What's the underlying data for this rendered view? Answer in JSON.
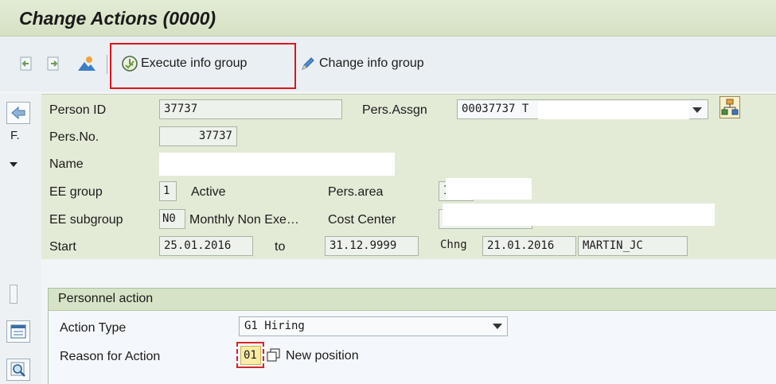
{
  "title": "Change Actions (0000)",
  "toolbar": {
    "execute_label": "Execute info group",
    "change_label": "Change info group",
    "highlight_color": "#e0141b"
  },
  "leftnav": {
    "f_label": "F."
  },
  "header": {
    "person_id_label": "Person ID",
    "person_id_value": "37737",
    "pers_assgn_label": "Pers.Assgn",
    "pers_assgn_value": "00037737 T",
    "pers_no_label": "Pers.No.",
    "pers_no_value": "37737",
    "name_label": "Name",
    "ee_group_label": "EE group",
    "ee_group_code": "1",
    "ee_group_text": "Active",
    "pers_area_label": "Pers.area",
    "pers_area_value": "I",
    "ee_subgroup_label": "EE subgroup",
    "ee_subgroup_code": "N0",
    "ee_subgroup_text": "Monthly Non Exe…",
    "cost_center_label": "Cost Center",
    "start_label": "Start",
    "start_value": "25.01.2016",
    "to_label": "to",
    "end_value": "31.12.9999",
    "chng_label": "Chng",
    "chng_date": "21.01.2016",
    "chng_user": "MARTIN_JC"
  },
  "personnel_action": {
    "group_title": "Personnel action",
    "action_type_label": "Action Type",
    "action_type_value": "G1 Hiring",
    "reason_label": "Reason for Action",
    "reason_code": "01",
    "reason_text": "New position"
  }
}
